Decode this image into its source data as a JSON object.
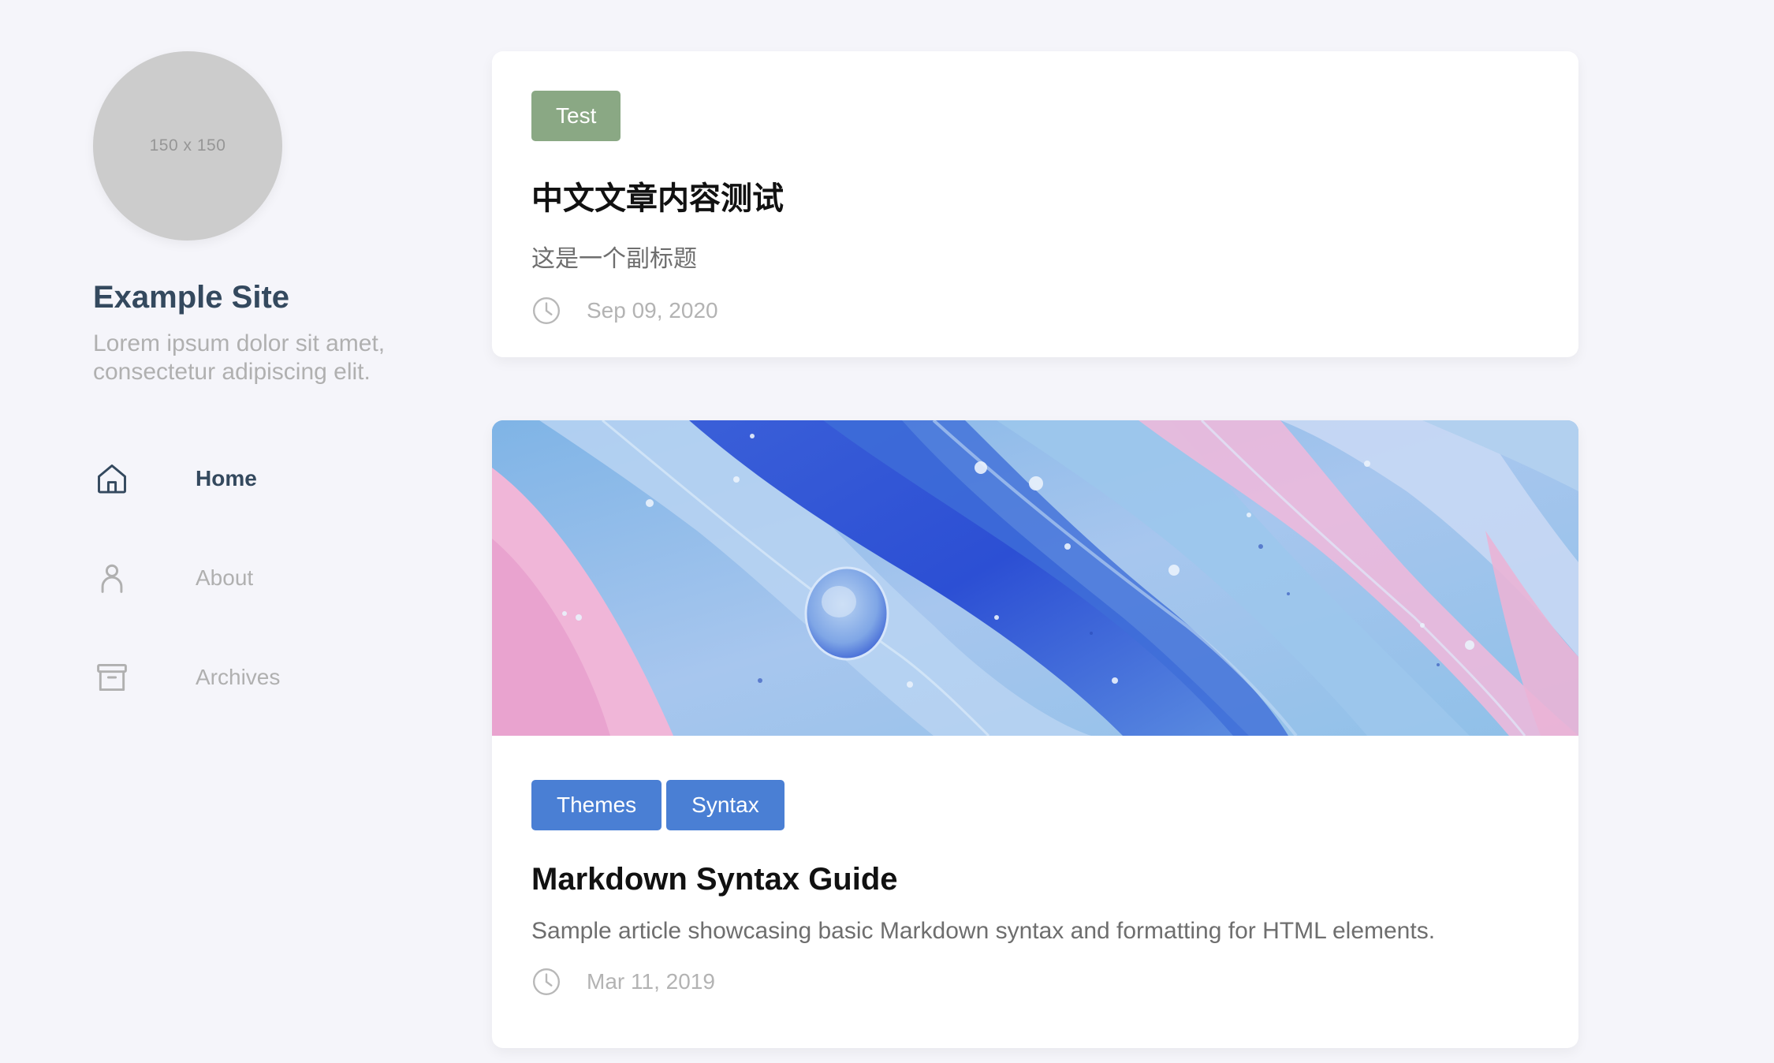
{
  "site": {
    "avatar_text": "150 x 150",
    "title": "Example Site",
    "description": "Lorem ipsum dolor sit amet, consectetur adipiscing elit."
  },
  "menu": [
    {
      "label": "Home",
      "icon": "home-icon",
      "active": true
    },
    {
      "label": "About",
      "icon": "user-icon",
      "active": false
    },
    {
      "label": "Archives",
      "icon": "archive-icon",
      "active": false
    }
  ],
  "posts": [
    {
      "tags": [
        "Test"
      ],
      "title": "中文文章内容测试",
      "subtitle": "这是一个副标题",
      "date": "Sep 09, 2020",
      "has_cover": false
    },
    {
      "tags": [
        "Themes",
        "Syntax"
      ],
      "title": "Markdown Syntax Guide",
      "subtitle": "Sample article showcasing basic Markdown syntax and formatting for HTML elements.",
      "date": "Mar 11, 2019",
      "has_cover": true
    }
  ],
  "colors": {
    "background": "#f5f5fa",
    "title_color": "#34495e",
    "tag_green": "#8aa884",
    "tag_blue": "#4a7fd4",
    "muted": "#b0b0b0"
  }
}
